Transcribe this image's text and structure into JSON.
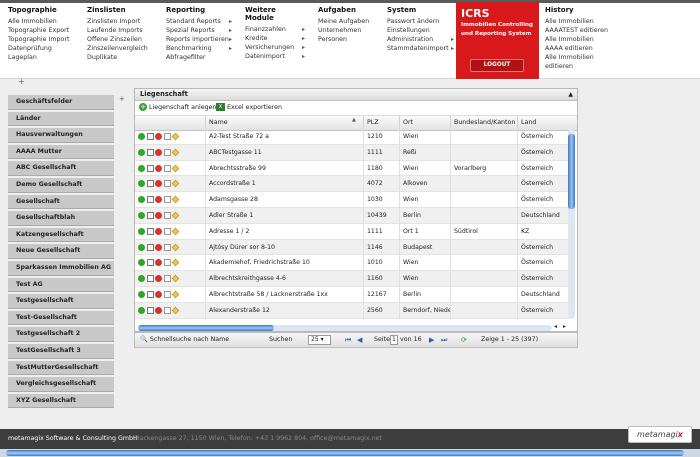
{
  "menus": [
    {
      "title": "Topographie",
      "items": [
        "Alle Immobilien",
        "Topographie Export",
        "Topographie Import",
        "Datenprüfung",
        "Lageplan"
      ],
      "arrows": []
    },
    {
      "title": "Zinslisten",
      "items": [
        "Zinslisten Import",
        "Laufende Imports",
        "Offene Zinszeilen",
        "Zinszeilenvergleich",
        "Duplikate"
      ],
      "arrows": []
    },
    {
      "title": "Reporting",
      "items": [
        "Standard Reports",
        "Spezial Reports",
        "Reports importieren",
        "Benchmarking",
        "Abfragefilter"
      ],
      "arrows": [
        0,
        1,
        2,
        3
      ]
    },
    {
      "title": "Weitere Module",
      "items": [
        "Finanzzahlen",
        "Kredite",
        "Versicherungen",
        "Datenimport"
      ],
      "arrows": [
        0,
        1,
        2,
        3
      ]
    },
    {
      "title": "Aufgaben",
      "items": [
        "Meine Aufgaben",
        "Unternehmen",
        "Personen"
      ],
      "arrows": []
    },
    {
      "title": "System",
      "items": [
        "Passwort ändern",
        "Einstellungen",
        "Administration",
        "Stammdatenimport"
      ],
      "arrows": [
        2,
        3
      ]
    },
    {
      "title": "History",
      "items": [
        "Alle Immobilien",
        "AAAATEST editieren",
        "Alle Immobilien",
        "AAAA editieren",
        "Alle Immobilien",
        "editieren"
      ],
      "arrows": []
    }
  ],
  "icrs": {
    "title": "ICRS",
    "subtitle_1": "Immobilien Controlling",
    "subtitle_2": "und Reporting System",
    "logout": "LOGOUT"
  },
  "sidebar": {
    "items": [
      "Geschäftsfelder",
      "Länder",
      "Hausverwaltungen",
      "AAAA Mutter",
      "ABC Gesellschaft",
      "Demo Gesellschaft",
      "Gesellschaft",
      "Gesellschaftblah",
      "Katzengesellschaft",
      "Neue Gesellschaft",
      "Sparkassen Immobilien AG",
      "Test AG",
      "Testgesellschaft",
      "Test-Gesellschaft",
      "Testgesellschaft 2",
      "TestGesellschaft 3",
      "TestMutterGesellschaft",
      "Vergleichsgesellschaft",
      "XYZ Gesellschaft"
    ]
  },
  "panel": {
    "title": "Liegenschaft",
    "add_label": "Liegenschaft anlegen",
    "export_label": "Excel exportieren",
    "columns": {
      "name": "Name",
      "plz": "PLZ",
      "ort": "Ort",
      "bundesland": "Bundesland/Kanton",
      "land": "Land"
    },
    "rows": [
      {
        "name": "A2-Test Straße 72 a",
        "plz": "1210",
        "ort": "Wien",
        "bundesland": "",
        "land": "Österreich"
      },
      {
        "name": "ABCTestgasse 11",
        "plz": "1111",
        "ort": "Reßi",
        "bundesland": "",
        "land": "Österreich"
      },
      {
        "name": "Abrechtsstraße 99",
        "plz": "1180",
        "ort": "Wien",
        "bundesland": "Vorarlberg",
        "land": "Österreich"
      },
      {
        "name": "Accordstraße 1",
        "plz": "4072",
        "ort": "Alkoven",
        "bundesland": "",
        "land": "Österreich"
      },
      {
        "name": "Adamsgasse 28",
        "plz": "1030",
        "ort": "Wien",
        "bundesland": "",
        "land": "Österreich"
      },
      {
        "name": "Adler Straße 1",
        "plz": "10439",
        "ort": "Berlin",
        "bundesland": "",
        "land": "Deutschland"
      },
      {
        "name": "Adresse 1 / 2",
        "plz": "1111",
        "ort": "Ort 1",
        "bundesland": "Südtirol",
        "land": "KZ"
      },
      {
        "name": "Ajtósy Dürer sor 8-10",
        "plz": "1146",
        "ort": "Budapest",
        "bundesland": "",
        "land": "Österreich"
      },
      {
        "name": "Akademiehof, Friedrichstraße 10",
        "plz": "1010",
        "ort": "Wien",
        "bundesland": "",
        "land": "Österreich"
      },
      {
        "name": "Albrechtskreithgasse 4-6",
        "plz": "1160",
        "ort": "Wien",
        "bundesland": "",
        "land": "Österreich"
      },
      {
        "name": "Albrechtstraße 58 / Lacknerstraße 1xx",
        "plz": "12167",
        "ort": "Berlin",
        "bundesland": "",
        "land": "Deutschland"
      },
      {
        "name": "Alexanderstraße 12",
        "plz": "2560",
        "ort": "Berndorf, Niederö",
        "bundesland": "",
        "land": "Österreich"
      }
    ]
  },
  "pager": {
    "search_label": "Schnellsuche nach Name",
    "search_button": "Suchen",
    "page_size": "25",
    "page_label": "Seite",
    "page_value": "1",
    "of_label": "von 16",
    "summary": "Zeige 1 - 25 (397)"
  },
  "footer": {
    "company": "metamagix Software & Consulting GmbH",
    "address": "Hackengasse 27, 1150 Wien, Telefon: +43 1 9962 804, office@metamagix.net",
    "logo_text": "metamagi",
    "logo_x": "x"
  }
}
